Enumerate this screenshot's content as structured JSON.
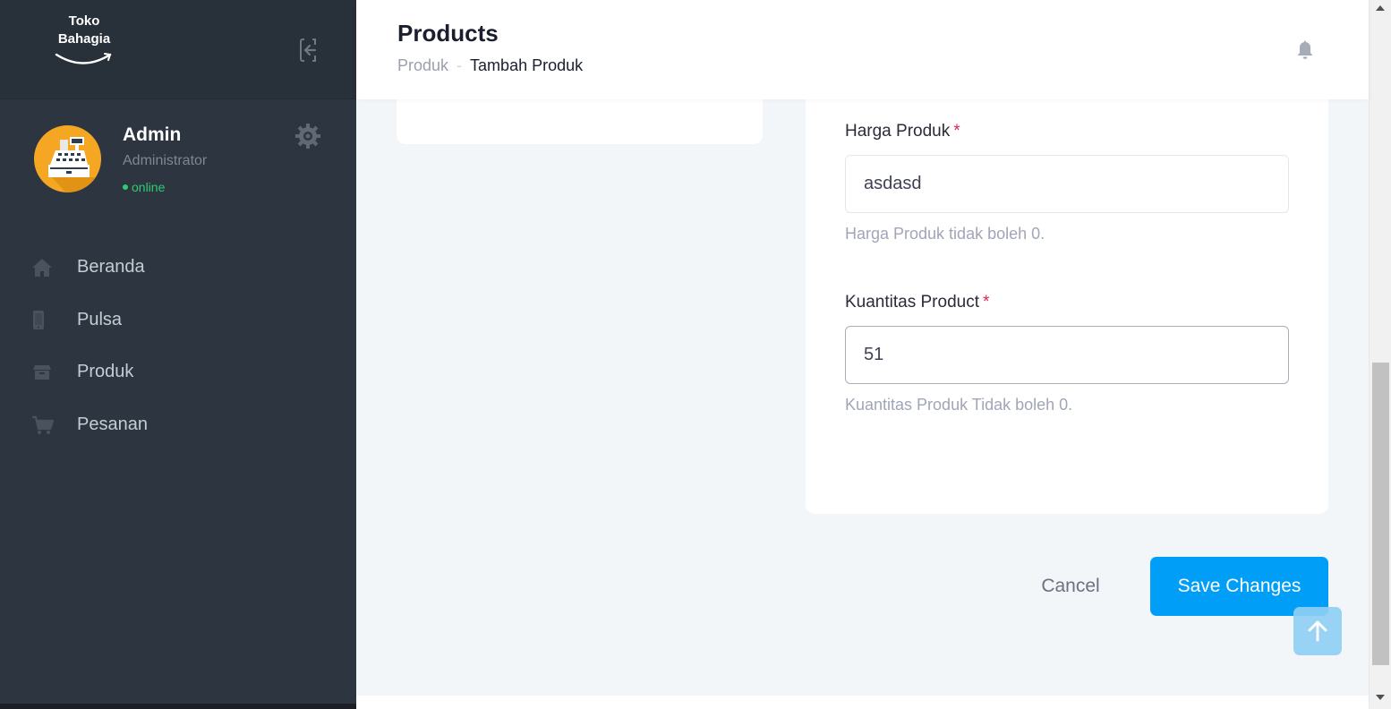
{
  "brand": {
    "line1": "Toko",
    "line2": "Bahagia"
  },
  "profile": {
    "name": "Admin",
    "role": "Administrator",
    "status": "online"
  },
  "nav": [
    {
      "label": "Beranda",
      "icon": "home-icon"
    },
    {
      "label": "Pulsa",
      "icon": "phone-icon"
    },
    {
      "label": "Produk",
      "icon": "box-icon"
    },
    {
      "label": "Pesanan",
      "icon": "cart-icon"
    }
  ],
  "header": {
    "title": "Products",
    "breadcrumb": {
      "parent": "Produk",
      "separator": "-",
      "current": "Tambah Produk"
    }
  },
  "form": {
    "price": {
      "label": "Harga Produk",
      "required_mark": "*",
      "value": "asdasd",
      "help": "Harga Produk tidak boleh 0."
    },
    "quantity": {
      "label": "Kuantitas Product",
      "required_mark": "*",
      "value": "51",
      "help": "Kuantitas Produk Tidak boleh 0."
    }
  },
  "actions": {
    "cancel": "Cancel",
    "save": "Save Changes"
  },
  "colors": {
    "sidebar": "#2d3640",
    "primary": "#009ef7",
    "online": "#2ecc71",
    "required": "#e0245e"
  }
}
